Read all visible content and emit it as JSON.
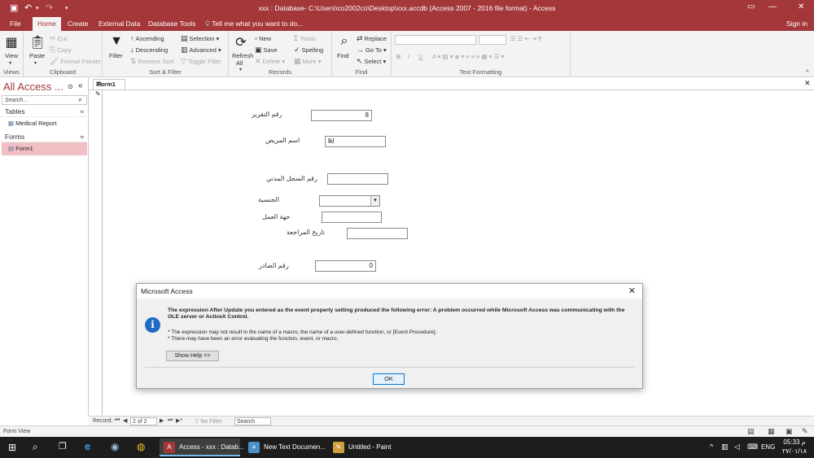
{
  "window": {
    "title": "xxx : Database- C:\\Users\\co2002co\\Desktop\\xxx.accdb (Access 2007 - 2016 file format) - Access"
  },
  "tabs": [
    {
      "label": "File"
    },
    {
      "label": "Home"
    },
    {
      "label": "Create"
    },
    {
      "label": "External Data"
    },
    {
      "label": "Database Tools"
    }
  ],
  "tell_me": "Tell me what you want to do...",
  "sign_in": "Sign in",
  "ribbon": {
    "views": {
      "view": "View",
      "group": "Views"
    },
    "clipboard": {
      "paste": "Paste",
      "cut": "Cut",
      "copy": "Copy",
      "format_painter": "Format Painter",
      "group": "Clipboard"
    },
    "sort_filter": {
      "filter": "Filter",
      "ascending": "Ascending",
      "descending": "Descending",
      "remove_sort": "Remove Sort",
      "selection": "Selection",
      "advanced": "Advanced",
      "toggle_filter": "Toggle Filter",
      "group": "Sort & Filter"
    },
    "records": {
      "refresh": "Refresh",
      "all": "All",
      "new": "New",
      "save": "Save",
      "delete": "Delete",
      "totals": "Totals",
      "spelling": "Spelling",
      "more": "More",
      "group": "Records"
    },
    "find": {
      "find": "Find",
      "replace": "Replace",
      "goto": "Go To",
      "select": "Select",
      "group": "Find"
    },
    "text_formatting": {
      "bold": "B",
      "italic": "I",
      "underline": "U",
      "group": "Text Formatting"
    }
  },
  "nav": {
    "title": "All Access ...",
    "search_placeholder": "Search...",
    "sections": [
      {
        "label": "Tables",
        "items": [
          "Medical Report"
        ]
      },
      {
        "label": "Forms",
        "items": [
          "Form1"
        ]
      }
    ]
  },
  "document": {
    "tab_label": "Form1"
  },
  "form": {
    "report_no_label": "رقم التقرير",
    "report_no_value": "8",
    "patient_name_label": "اسم المريض",
    "patient_name_value": "lkl",
    "civil_record_label": "رقم السجل المدني",
    "civil_record_value": "",
    "nationality_label": "الجنسية",
    "nationality_value": "",
    "work_place_label": "جهة العمل",
    "work_place_value": "",
    "review_date_label": "تاريخ المراجعة",
    "review_date_value": "",
    "outgoing_no_label": "رقم الصادر",
    "outgoing_no_value": "0"
  },
  "record_nav": {
    "label": "Record:",
    "position": "2 of 2",
    "filter": "No Filter",
    "search": "Search"
  },
  "status": {
    "text": "Form View"
  },
  "dialog": {
    "title": "Microsoft Access",
    "message": "The expression After Update you entered as the event property setting produced the following error: A problem occurred while Microsoft Access was communicating with the OLE server or ActiveX Control.",
    "bullet1": "* The expression may not result in the name of a macro, the name of a user-defined function, or [Event Procedure].",
    "bullet2": "* There may have been an error evaluating the function, event, or macro.",
    "help_button": "Show Help >>",
    "ok_button": "OK"
  },
  "taskbar": {
    "apps": [
      {
        "label": "Access - xxx : Datab...",
        "icon": "access-icon"
      },
      {
        "label": "New Text Documen...",
        "icon": "notepad-icon"
      },
      {
        "label": "Untitled - Paint",
        "icon": "paint-icon"
      }
    ],
    "language": "ENG",
    "time": "05:33 م",
    "date": "٢٧/٠١/١٨"
  },
  "colors": {
    "accent": "#a4373a",
    "ribbon_bg": "#f3f3f3",
    "selected_nav": "#f0c0c4",
    "info_blue": "#1e6bc4"
  }
}
